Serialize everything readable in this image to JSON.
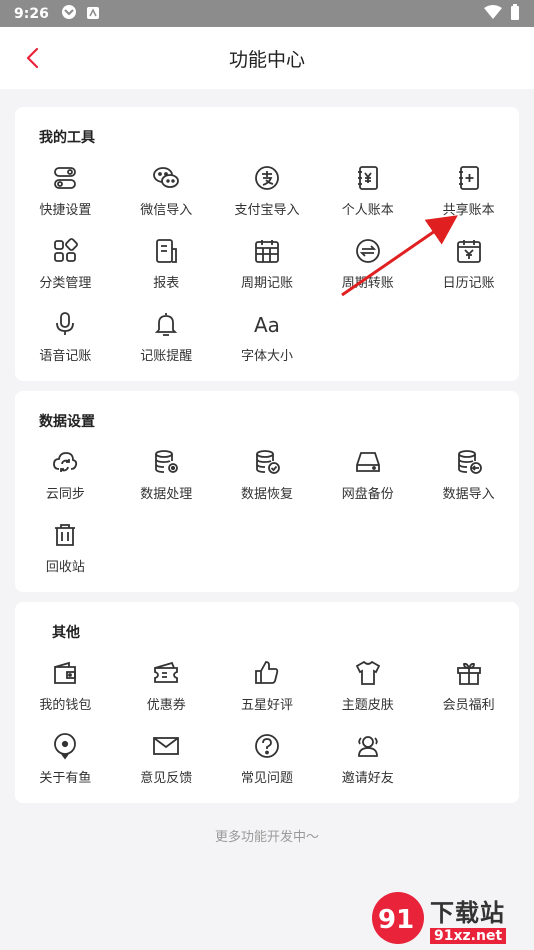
{
  "status_bar": {
    "time": "9:26"
  },
  "header": {
    "title": "功能中心"
  },
  "sections": [
    {
      "title": "我的工具",
      "items": [
        {
          "label": "快捷设置",
          "icon": "toggle-icon"
        },
        {
          "label": "微信导入",
          "icon": "wechat-icon"
        },
        {
          "label": "支付宝导入",
          "icon": "alipay-icon"
        },
        {
          "label": "个人账本",
          "icon": "personal-book-icon"
        },
        {
          "label": "共享账本",
          "icon": "shared-book-icon"
        },
        {
          "label": "分类管理",
          "icon": "category-icon"
        },
        {
          "label": "报表",
          "icon": "report-icon"
        },
        {
          "label": "周期记账",
          "icon": "calendar-grid-icon"
        },
        {
          "label": "周期转账",
          "icon": "transfer-icon"
        },
        {
          "label": "日历记账",
          "icon": "calendar-yen-icon"
        },
        {
          "label": "语音记账",
          "icon": "microphone-icon"
        },
        {
          "label": "记账提醒",
          "icon": "bell-icon"
        },
        {
          "label": "字体大小",
          "icon": "font-size-icon"
        }
      ]
    },
    {
      "title": "数据设置",
      "items": [
        {
          "label": "云同步",
          "icon": "cloud-sync-icon"
        },
        {
          "label": "数据处理",
          "icon": "database-gear-icon"
        },
        {
          "label": "数据恢复",
          "icon": "database-check-icon"
        },
        {
          "label": "网盘备份",
          "icon": "drive-icon"
        },
        {
          "label": "数据导入",
          "icon": "database-import-icon"
        },
        {
          "label": "回收站",
          "icon": "trash-icon"
        }
      ]
    },
    {
      "title": "其他",
      "items": [
        {
          "label": "我的钱包",
          "icon": "wallet-icon"
        },
        {
          "label": "优惠券",
          "icon": "coupon-icon"
        },
        {
          "label": "五星好评",
          "icon": "thumbs-up-icon"
        },
        {
          "label": "主题皮肤",
          "icon": "shirt-icon"
        },
        {
          "label": "会员福利",
          "icon": "gift-icon"
        },
        {
          "label": "关于有鱼",
          "icon": "location-icon"
        },
        {
          "label": "意见反馈",
          "icon": "mail-icon"
        },
        {
          "label": "常见问题",
          "icon": "question-icon"
        },
        {
          "label": "邀请好友",
          "icon": "invite-friends-icon"
        }
      ]
    }
  ],
  "footer": {
    "note": "更多功能开发中～"
  },
  "watermark": {
    "main": "下载站",
    "sub": "91xz.net",
    "logo_text": "91"
  },
  "colors": {
    "accent": "#e8233a",
    "annotation_arrow": "#e02020",
    "status_bar": "#8c8c8c"
  }
}
